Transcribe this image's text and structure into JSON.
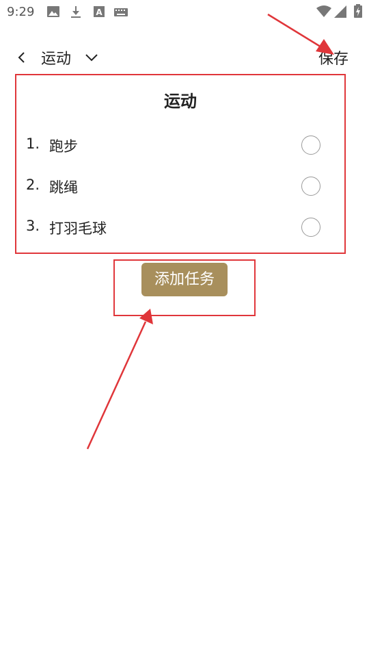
{
  "status_bar": {
    "time": "9:29",
    "icons": [
      "image-icon",
      "download-icon",
      "font-icon",
      "keyboard-icon",
      "wifi-icon",
      "signal-icon",
      "battery-charging-icon"
    ]
  },
  "header": {
    "title": "运动",
    "save_label": "保存"
  },
  "card": {
    "title": "运动",
    "tasks": [
      {
        "number": "1.",
        "label": "跑步",
        "checked": false
      },
      {
        "number": "2.",
        "label": "跳绳",
        "checked": false
      },
      {
        "number": "3.",
        "label": "打羽毛球",
        "checked": false
      }
    ]
  },
  "add_button_label": "添加任务",
  "colors": {
    "accent_button": "#a88f5c",
    "annotation": "#e0363a",
    "radio_border": "#9a9a9a"
  }
}
